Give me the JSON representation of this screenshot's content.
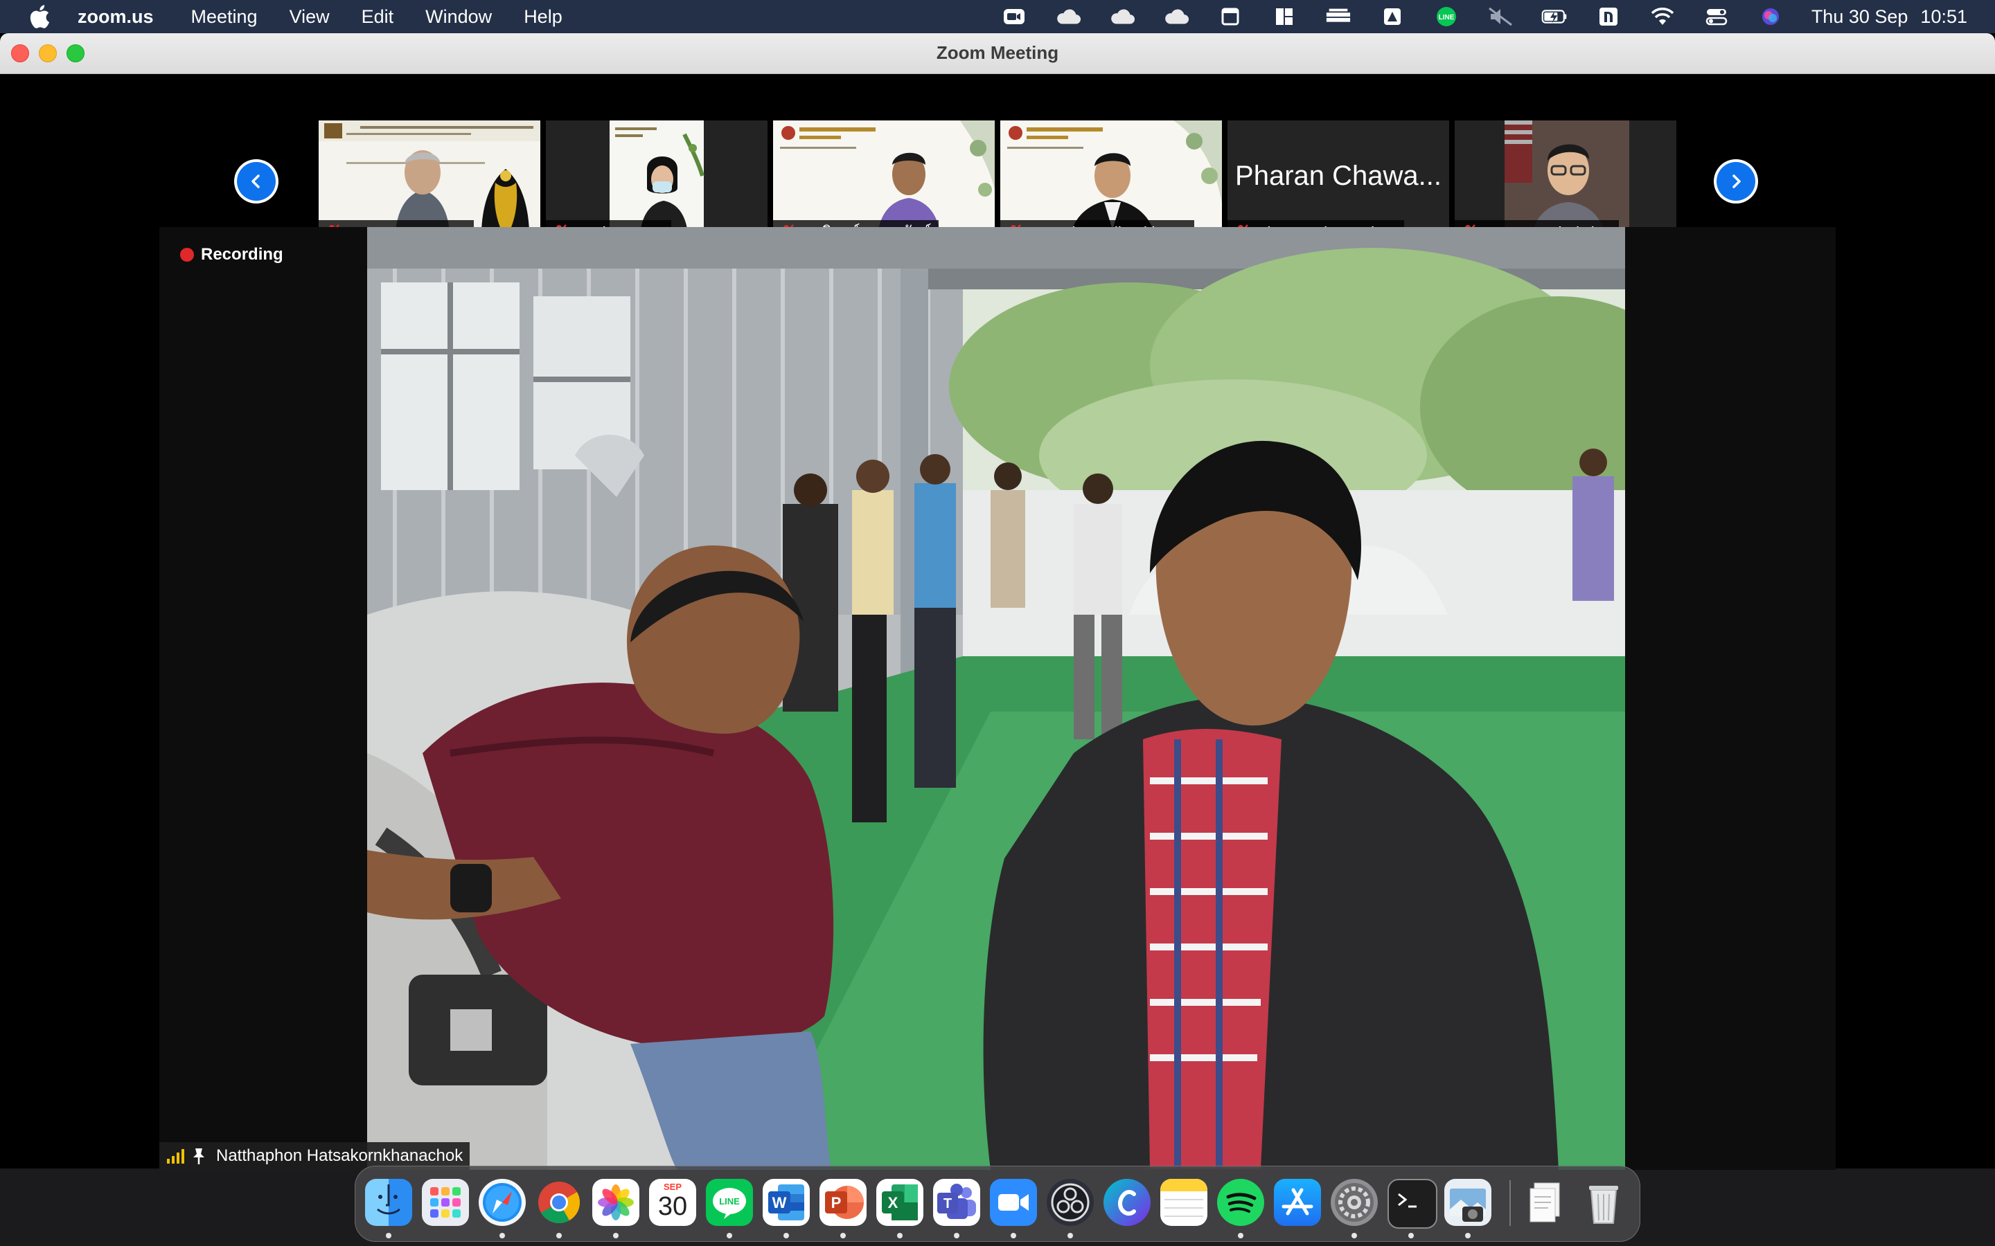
{
  "menubar": {
    "app_name": "zoom.us",
    "menus": [
      "Meeting",
      "View",
      "Edit",
      "Window",
      "Help"
    ],
    "status_icons": [
      "zoom-video-icon",
      "cloud-icon",
      "cloud-icon",
      "cloud-icon",
      "square-icon",
      "layout-icon",
      "stack-icon",
      "arrow-box-icon",
      "line-icon",
      "mute-icon",
      "battery-icon",
      "n-icon",
      "wifi-icon",
      "control-center-icon",
      "siri-icon"
    ],
    "date": "Thu 30 Sep",
    "time": "10:51"
  },
  "window": {
    "title": "Zoom Meeting"
  },
  "participants": [
    {
      "name": "สุนทร ละอองนวล",
      "muted": true,
      "video": true
    },
    {
      "name": "Kasina.rmutt",
      "muted": true,
      "video": true
    },
    {
      "name": "พรภิรมย์ หลงทรัพย์",
      "muted": true,
      "video": true
    },
    {
      "name": "Tongchart Pikoolthong",
      "muted": true,
      "video": true
    },
    {
      "name": "Pharan Chawaphan",
      "muted": true,
      "video": false,
      "display_name": "Pharan Chawa..."
    },
    {
      "name": "Natawut Chaiwino",
      "muted": true,
      "video": true
    }
  ],
  "main": {
    "recording_label": "Recording",
    "speaker_name": "Natthaphon Hatsakornkhanachok"
  },
  "dock": {
    "calendar_month": "SEP",
    "calendar_day": "30",
    "apps": [
      "Finder",
      "Launchpad",
      "Safari",
      "Chrome",
      "Photos",
      "Calendar",
      "LINE",
      "Word",
      "PowerPoint",
      "Excel",
      "Teams",
      "Zoom",
      "OBS",
      "Canva",
      "Notes",
      "Spotify",
      "App Store",
      "System Preferences",
      "Terminal",
      "Preview",
      "Downloads",
      "Trash"
    ]
  },
  "colors": {
    "menubar": "#233048",
    "zoom_blue": "#0e72ed",
    "recording_red": "#e02828",
    "muted_red": "#e02828"
  }
}
